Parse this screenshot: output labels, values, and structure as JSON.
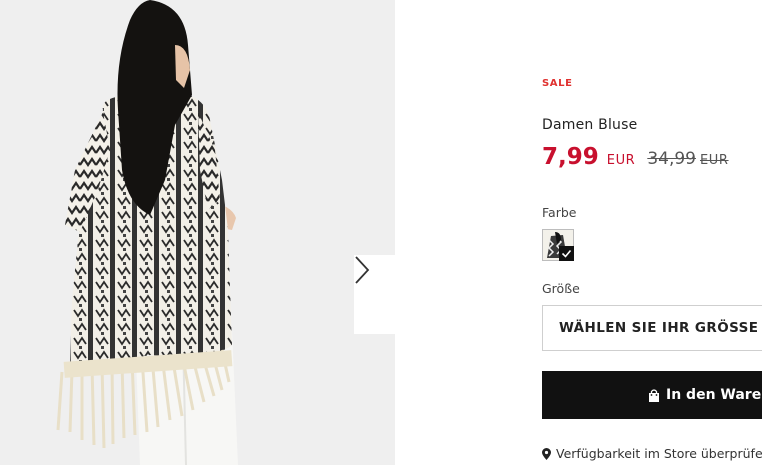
{
  "product": {
    "badge": "SALE",
    "title": "Damen Bluse",
    "price": {
      "current": "7,99",
      "current_currency": "EUR",
      "original": "34,99",
      "original_currency": "EUR",
      "sale_color": "#c8102e"
    }
  },
  "color": {
    "label": "Farbe",
    "selected_icon": "check-icon"
  },
  "size": {
    "label": "Größe",
    "placeholder": "WÄHLEN SIE IHR GRÖSSE"
  },
  "actions": {
    "add_to_cart": "In den Waren",
    "cart_icon": "shopping-bag-icon",
    "store_availability": "Verfügbarkeit im Store überprüfen",
    "store_icon": "map-pin-icon"
  },
  "gallery": {
    "next_icon": "chevron-right-icon"
  }
}
